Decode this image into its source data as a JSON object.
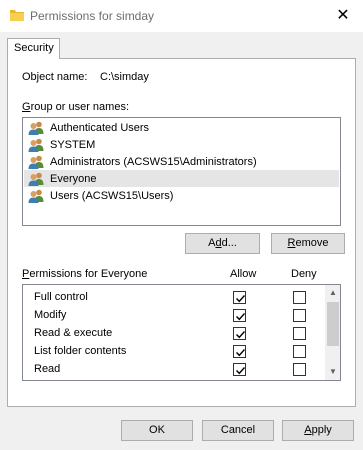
{
  "window": {
    "title": "Permissions for simday"
  },
  "tabs": [
    {
      "label": "Security"
    }
  ],
  "object": {
    "label": "Object name:",
    "value": "C:\\simday"
  },
  "groups": {
    "label": "Group or user names:",
    "items": [
      {
        "label": "Authenticated Users",
        "selected": false
      },
      {
        "label": "SYSTEM",
        "selected": false
      },
      {
        "label": "Administrators (ACSWS15\\Administrators)",
        "selected": false
      },
      {
        "label": "Everyone",
        "selected": true
      },
      {
        "label": "Users (ACSWS15\\Users)",
        "selected": false
      }
    ]
  },
  "buttons": {
    "add": {
      "pre": "A",
      "mn": "d",
      "post": "d..."
    },
    "remove": {
      "pre": "",
      "mn": "R",
      "post": "emove"
    },
    "ok": "OK",
    "cancel": "Cancel",
    "apply": {
      "pre": "",
      "mn": "A",
      "post": "pply"
    }
  },
  "permissions": {
    "label": "Permissions for Everyone",
    "allow_header": "Allow",
    "deny_header": "Deny",
    "items": [
      {
        "name": "Full control",
        "allow": true,
        "deny": false
      },
      {
        "name": "Modify",
        "allow": true,
        "deny": false
      },
      {
        "name": "Read & execute",
        "allow": true,
        "deny": false
      },
      {
        "name": "List folder contents",
        "allow": true,
        "deny": false
      },
      {
        "name": "Read",
        "allow": true,
        "deny": false
      },
      {
        "name": "",
        "allow": true,
        "deny": false
      }
    ]
  },
  "icons": {
    "title": "folder-icon",
    "users": "user-group-icon",
    "close": "close-icon",
    "scroll_up": "chevron-up-icon",
    "scroll_down": "chevron-down-icon"
  }
}
